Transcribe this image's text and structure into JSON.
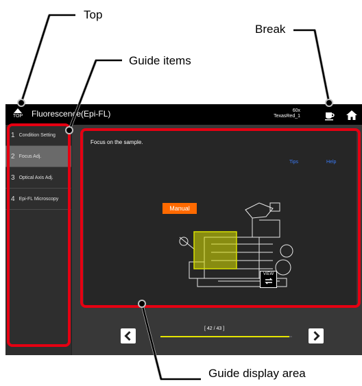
{
  "callouts": {
    "top": "Top",
    "break": "Break",
    "guide_items": "Guide items",
    "guide_display": "Guide display area"
  },
  "titlebar": {
    "top_button_label": "TOP",
    "title": "Fluorescence(Epi-FL)",
    "objective": "60x",
    "filter": "TexasRed_1",
    "break_icon": "coffee-cup-icon",
    "home_icon": "home-icon"
  },
  "sidebar": {
    "items": [
      {
        "num": "1",
        "label": "Condition Setting"
      },
      {
        "num": "2",
        "label": "Focus Adj.",
        "active": true
      },
      {
        "num": "3",
        "label": "Optical Axis Adj."
      },
      {
        "num": "4",
        "label": "Epi-FL Microscopy"
      }
    ]
  },
  "display": {
    "instruction": "Focus on the sample.",
    "tips": "Tips",
    "help": "Help",
    "manual_label": "Manual",
    "view_label_top": "VIEW",
    "view_label_icon": "swap-icon"
  },
  "navigation": {
    "progress_label": "[ 42 / 43 ]",
    "progress_fraction": 0.977,
    "prev_icon": "chevron-left-icon",
    "next_icon": "chevron-right-icon"
  },
  "colors": {
    "highlight": "#e50012",
    "accent_orange": "#ff6a00",
    "progress": "#e6e600",
    "link": "#3b7bf7"
  }
}
